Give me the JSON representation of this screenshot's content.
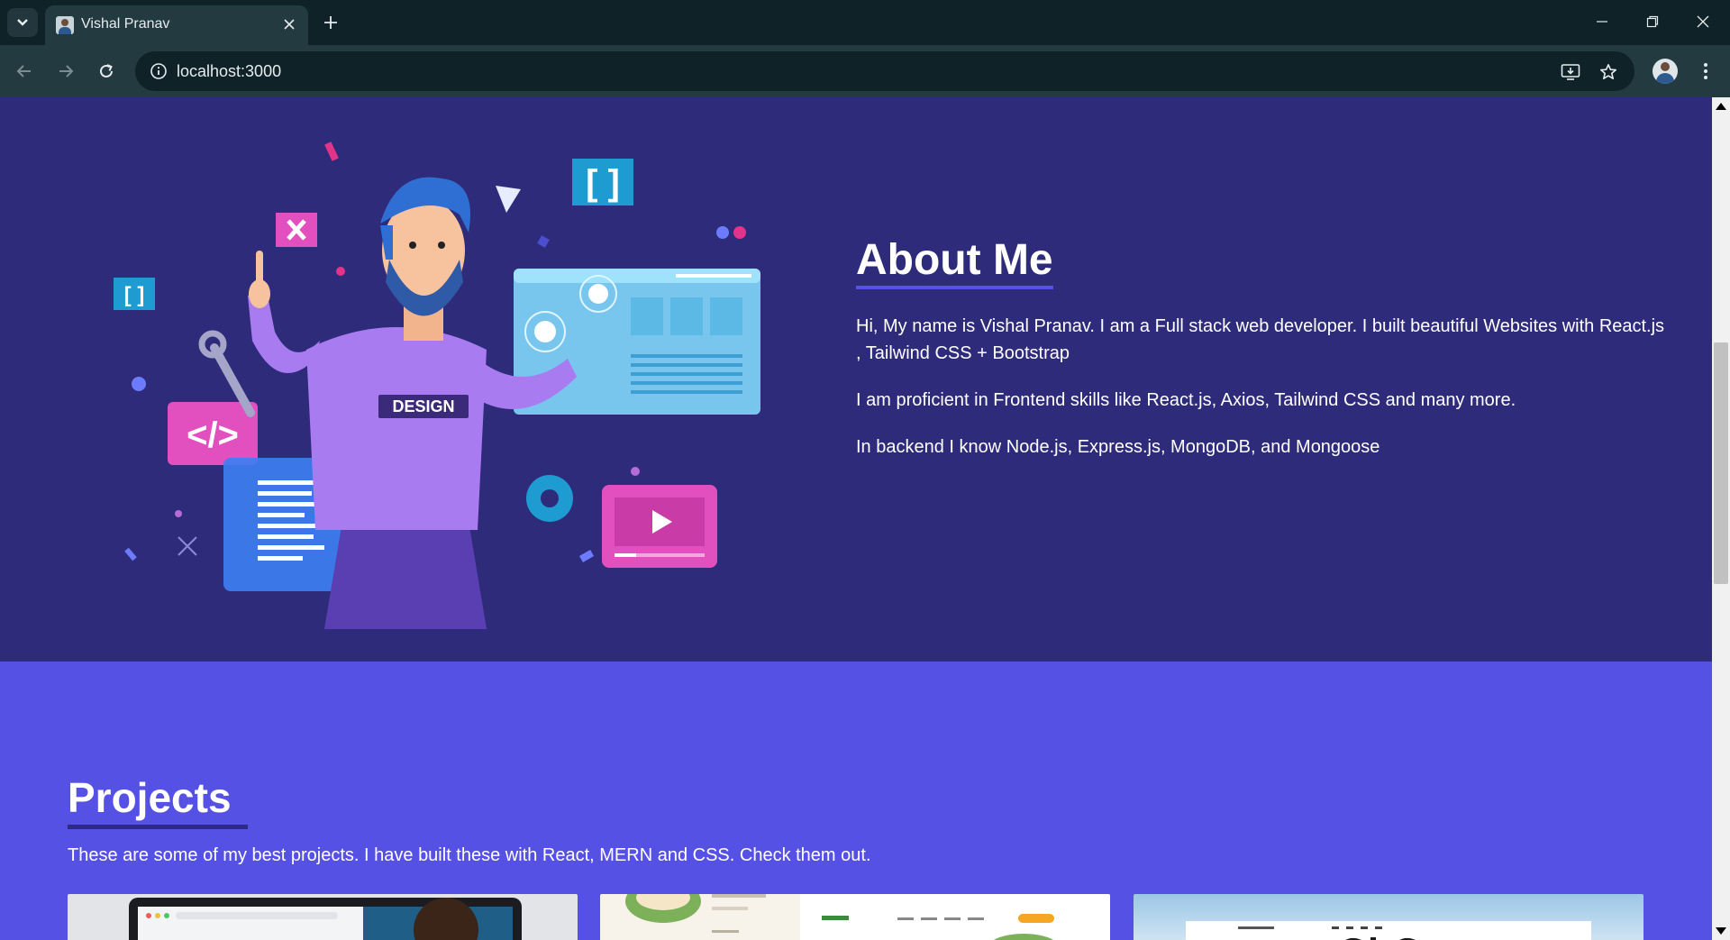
{
  "browser": {
    "tab_title": "Vishal Pranav",
    "url": "localhost:3000"
  },
  "about": {
    "title": "About Me",
    "paragraphs": [
      "Hi, My name is Vishal Pranav. I am a Full stack web developer. I built beautiful Websites with React.js , Tailwind CSS + Bootstrap",
      "I am proficient in Frontend skills like React.js, Axios, Tailwind CSS and many more.",
      "In backend I know Node.js, Express.js, MongoDB, and Mongoose"
    ],
    "illustration_label": "DESIGN"
  },
  "projects": {
    "title": "Projects",
    "description": "These are some of my best projects. I have built these with React, MERN and CSS. Check them out."
  },
  "colors": {
    "about_bg": "#2e2b7a",
    "projects_bg": "#5651e5",
    "accent": "#5550e6"
  }
}
